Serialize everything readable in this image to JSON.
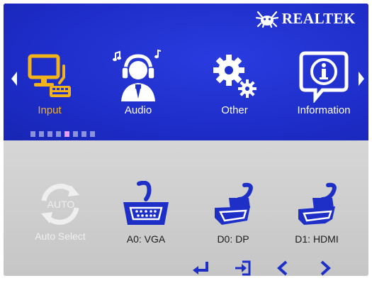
{
  "brand": {
    "name": "REALTEK",
    "logo_icon": "realtek-crab-logo"
  },
  "menu": {
    "items": [
      {
        "label": "Input",
        "icon": "monitor-keyboard-icon",
        "active": true
      },
      {
        "label": "Audio",
        "icon": "headphones-person-icon",
        "active": false
      },
      {
        "label": "Other",
        "icon": "gears-icon",
        "active": false
      },
      {
        "label": "Information",
        "icon": "info-bubble-icon",
        "active": false
      }
    ],
    "page_indicator": {
      "total": 8,
      "current": 5
    }
  },
  "sources": [
    {
      "label": "Auto Select",
      "icon_text": "AUTO",
      "enabled": false
    },
    {
      "label": "A0: VGA",
      "icon": "vga-connector-icon",
      "enabled": true
    },
    {
      "label": "D0: DP",
      "icon": "displayport-connector-icon",
      "enabled": true
    },
    {
      "label": "D1: HDMI",
      "icon": "hdmi-connector-icon",
      "enabled": true
    }
  ],
  "hotkeys": [
    "enter-icon",
    "exit-icon",
    "left-icon",
    "right-icon"
  ],
  "colors": {
    "header_blue": "#1f2fcc",
    "active_orange": "#f2b21a",
    "connector_blue": "#1e2fc8",
    "panel_gray": "#cfcfcf"
  }
}
